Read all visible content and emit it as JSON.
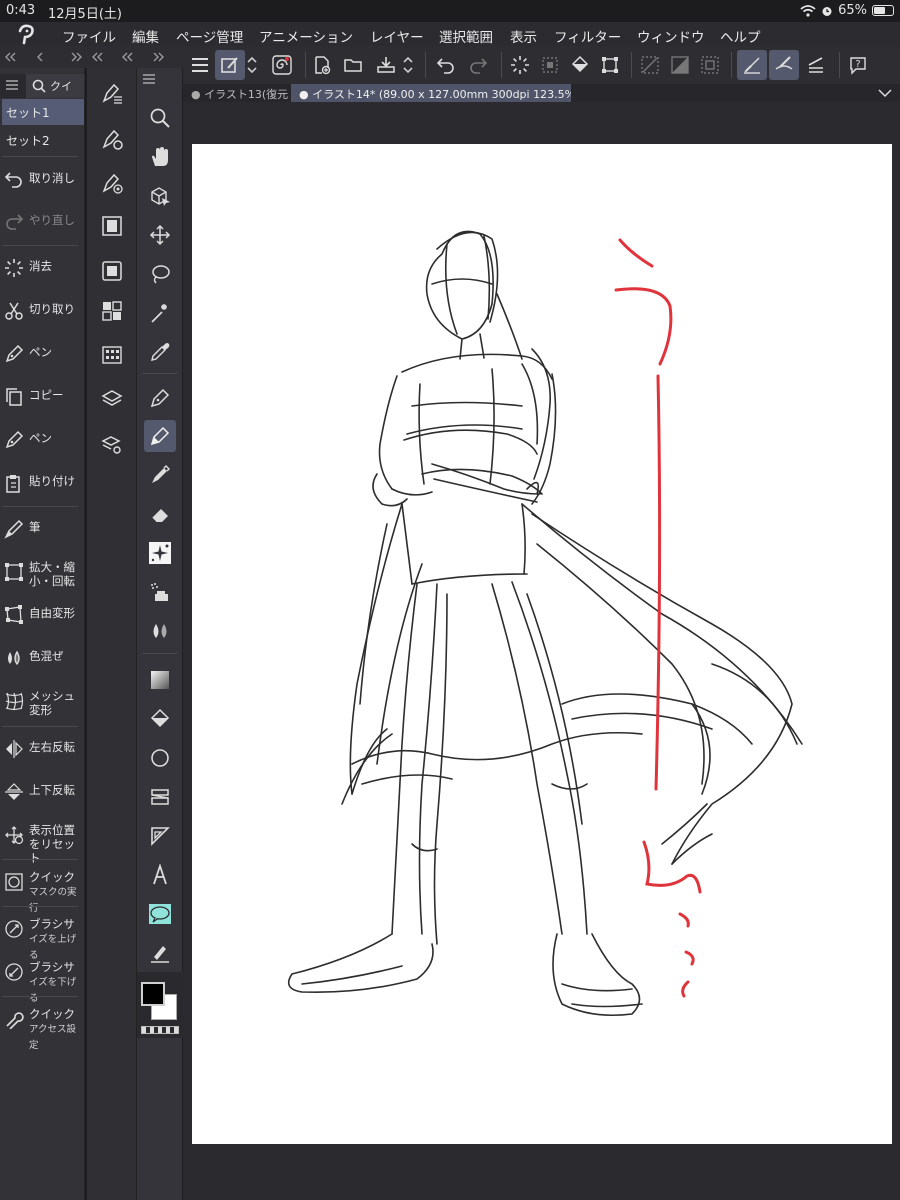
{
  "status_bar": {
    "time": "0:43",
    "date": "12月5日(土)",
    "battery": "65%",
    "battery_level": 0.65
  },
  "menu": [
    "ファイル",
    "編集",
    "ページ管理",
    "アニメーション",
    "レイヤー",
    "選択範囲",
    "表示",
    "フィルター",
    "ウィンドウ",
    "ヘルプ"
  ],
  "left_panel": {
    "tab_label": "クイ",
    "sets": [
      "セット1",
      "セット2"
    ],
    "commands": [
      {
        "label": "取り消し",
        "icon": "undo-icon"
      },
      {
        "label": "やり直し",
        "icon": "redo-icon"
      },
      {
        "label": "消去",
        "icon": "clear-icon"
      },
      {
        "label": "切り取り",
        "icon": "scissors-icon"
      },
      {
        "label": "ペン",
        "icon": "pen-icon"
      },
      {
        "label": "コピー",
        "icon": "copy-icon"
      },
      {
        "label": "ペン",
        "icon": "pen-icon"
      },
      {
        "label": "貼り付け",
        "icon": "paste-icon"
      },
      {
        "label": "筆",
        "icon": "brush-icon"
      },
      {
        "label": "拡大・縮",
        "label2": "小・回転",
        "icon": "scale-rotate-icon"
      },
      {
        "label": "自由変形",
        "icon": "free-transform-icon"
      },
      {
        "label": "色混ぜ",
        "icon": "blend-icon"
      },
      {
        "label": "メッシュ",
        "label2": "変形",
        "icon": "mesh-icon"
      },
      {
        "label": "左右反転",
        "icon": "flip-horizontal-icon"
      },
      {
        "label": "上下反転",
        "icon": "flip-vertical-icon"
      },
      {
        "label": "表示位置",
        "label2": "をリセット",
        "icon": "reset-view-icon"
      },
      {
        "label": "クイック",
        "label2": "マスクの実行",
        "icon": "quick-mask-icon"
      },
      {
        "label": "ブラシサ",
        "label2": "イズを上げる",
        "icon": "brush-size-up-icon"
      },
      {
        "label": "ブラシサ",
        "label2": "イズを下げる",
        "icon": "brush-size-down-icon"
      },
      {
        "label": "クイック",
        "label2": "アクセス設定",
        "icon": "wrench-icon"
      }
    ]
  },
  "doc_tabs": [
    {
      "label": "イラスト13(復元)",
      "active": false
    },
    {
      "label": "イラスト14* (89.00 x 127.00mm 300dpi 123.5%)",
      "active": true
    }
  ],
  "colors": {
    "accent": "#55596d",
    "main_color": "#000000",
    "sub_color": "#ffffff",
    "annotation": "#e0343c"
  }
}
